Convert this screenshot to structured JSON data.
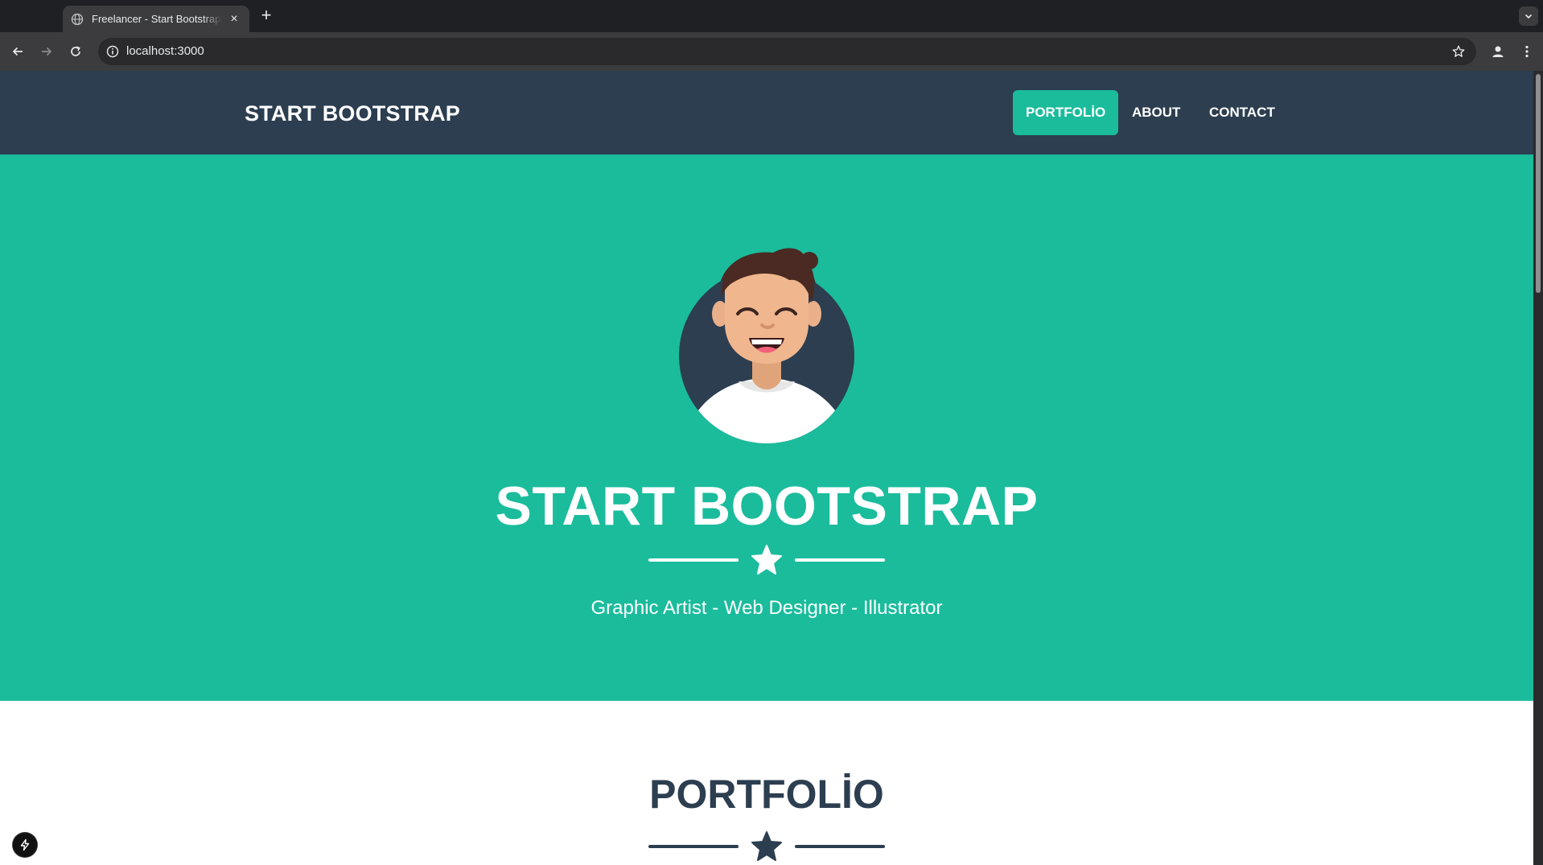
{
  "browser": {
    "tab_title": "Freelancer - Start Bootstrap Theme",
    "new_tab_label": "+",
    "url": "localhost:3000"
  },
  "site": {
    "brand": "START BOOTSTRAP",
    "nav": [
      {
        "label": "PORTFOLİO",
        "active": true
      },
      {
        "label": "ABOUT",
        "active": false
      },
      {
        "label": "CONTACT",
        "active": false
      }
    ]
  },
  "hero": {
    "avatar_icon": "avatar-illustration",
    "title": "START BOOTSTRAP",
    "subtitle": "Graphic Artist - Web Designer - Illustrator"
  },
  "portfolio": {
    "title": "PORTFOLİO"
  },
  "colors": {
    "nav_bg": "#2c3e50",
    "accent": "#1abc9c",
    "heading_dark": "#2c3e50",
    "white": "#ffffff"
  }
}
